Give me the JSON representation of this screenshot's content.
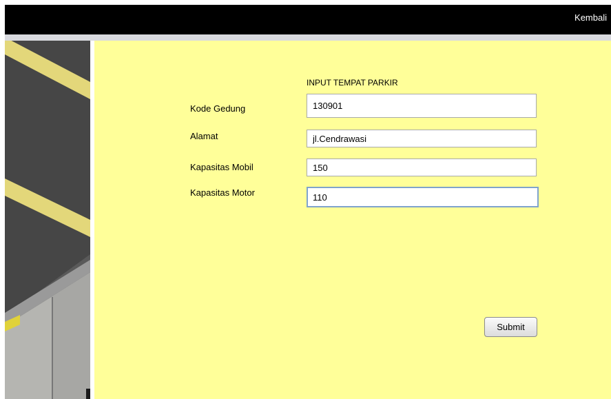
{
  "header": {
    "back_label": "Kembali"
  },
  "form": {
    "title": "INPUT TEMPAT PARKIR",
    "fields": [
      {
        "label": "Kode Gedung",
        "value": "130901"
      },
      {
        "label": "Alamat",
        "value": "jl.Cendrawasi"
      },
      {
        "label": "Kapasitas Mobil",
        "value": "150"
      },
      {
        "label": "Kapasitas Motor",
        "value": "110"
      }
    ],
    "submit_label": "Submit"
  },
  "colors": {
    "topbar": "#000000",
    "panel": "#ffff99",
    "strip": "#d9dadf"
  },
  "side_image": {
    "icon": "parking-lot-photo"
  }
}
